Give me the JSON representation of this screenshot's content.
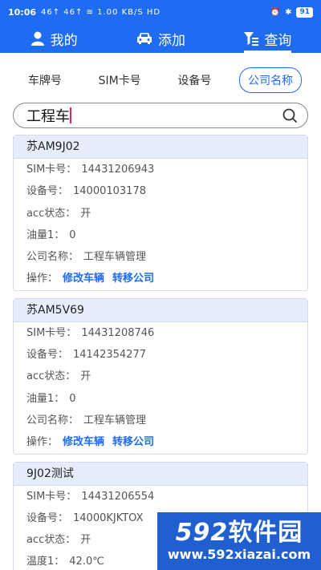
{
  "status_bar": {
    "time": "10:06",
    "signals": "46↑ 46↑ ≋ 1.00 KB/S HD",
    "battery": "91"
  },
  "nav": {
    "mine": "我的",
    "add": "添加",
    "query": "查询"
  },
  "filters": [
    "车牌号",
    "SIM卡号",
    "设备号",
    "公司名称"
  ],
  "search": {
    "value": "工程车"
  },
  "labels": {
    "sim": "SIM卡号：",
    "device": "设备号：",
    "acc": "acc状态：",
    "oil": "油量1：",
    "temp": "温度1：",
    "company": "公司名称：",
    "ops": "操作：",
    "edit": "修改车辆",
    "transfer": "转移公司"
  },
  "vehicles": [
    {
      "plate": "苏AM9J02",
      "sim": "14431206943",
      "device": "14000103178",
      "acc": "开",
      "oil": "0",
      "company": "工程车辆管理"
    },
    {
      "plate": "苏AM5V69",
      "sim": "14431208746",
      "device": "14142354277",
      "acc": "开",
      "oil": "0",
      "company": "工程车辆管理"
    },
    {
      "plate": "9J02测试",
      "sim": "14431206554",
      "device": "14000KJKTOX",
      "acc": "开",
      "temp": "42.0℃"
    }
  ],
  "watermark": {
    "brand_num": "592",
    "brand_text": "软件园",
    "url": "www.592xiazai.com"
  },
  "colors": {
    "primary": "#1f6cf2",
    "card_header": "#e6eefc"
  }
}
